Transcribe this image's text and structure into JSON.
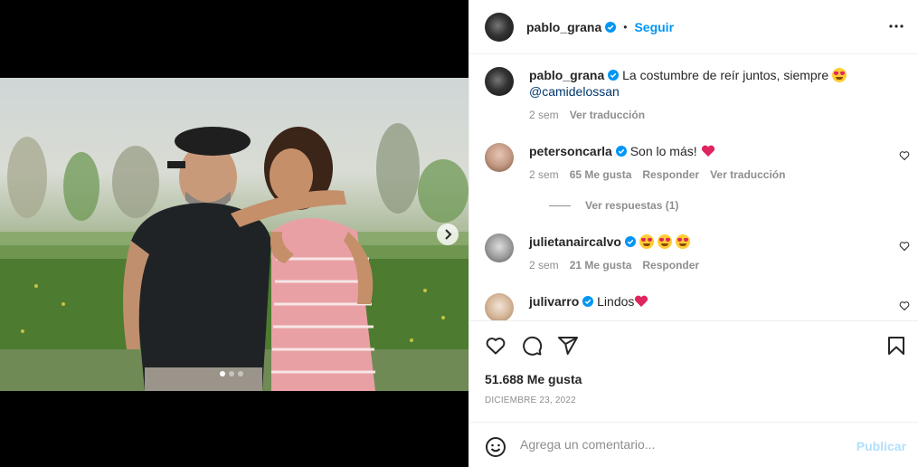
{
  "post": {
    "author": "pablo_grana",
    "follow_label": "Seguir",
    "separator": "•",
    "caption_text": "La costumbre de reír juntos, siempre",
    "caption_mention": "@camidelossan",
    "caption_time": "2 sem",
    "caption_translate": "Ver traducción"
  },
  "comments": [
    {
      "user": "petersoncarla",
      "text": "Son lo más!",
      "time": "2 sem",
      "likes": "65 Me gusta",
      "reply": "Responder",
      "translate": "Ver traducción",
      "view_replies": "Ver respuestas (1)"
    },
    {
      "user": "julietanaircalvo",
      "text": "",
      "time": "2 sem",
      "likes": "21 Me gusta",
      "reply": "Responder"
    },
    {
      "user": "julivarro",
      "text": "Lindos"
    }
  ],
  "stats": {
    "likes": "51.688 Me gusta",
    "date": "DICIEMBRE 23, 2022"
  },
  "composer": {
    "placeholder": "Agrega un comentario...",
    "publish": "Publicar"
  },
  "carousel": {
    "total": 3,
    "active": 1
  },
  "colors": {
    "accent": "#0095f6",
    "verified": "#0095f6",
    "muted": "#8e8e8e",
    "heart": "#ed4956"
  }
}
